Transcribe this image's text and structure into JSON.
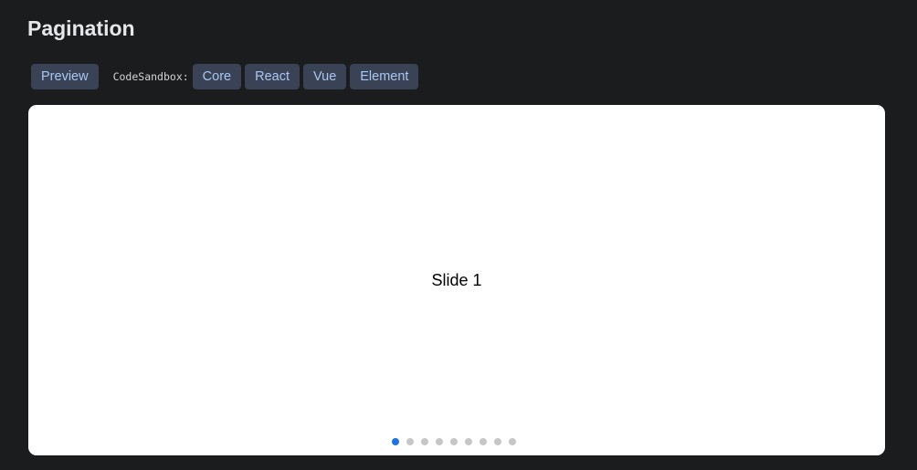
{
  "page": {
    "title": "Pagination"
  },
  "toolbar": {
    "preview_label": "Preview",
    "sandbox_label": "CodeSandbox:",
    "links": [
      "Core",
      "React",
      "Vue",
      "Element"
    ]
  },
  "swiper": {
    "slide_label": "Slide 1",
    "slide_count": 9,
    "active_index": 0,
    "active_color": "#1a73e8",
    "inactive_color": "#c7c7c7"
  },
  "colors": {
    "background": "#1b1c1e",
    "button_bg": "#3a4355",
    "button_text": "#a9c7f2"
  }
}
